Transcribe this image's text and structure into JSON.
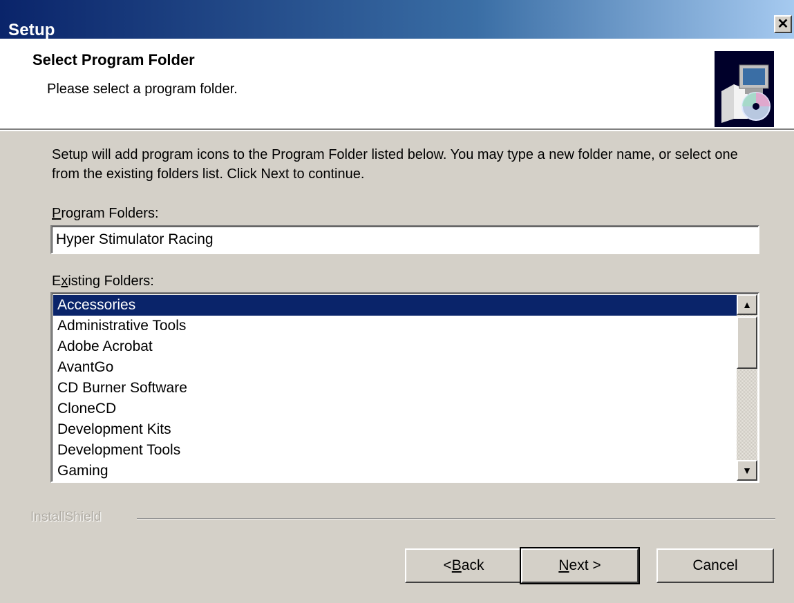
{
  "window": {
    "title": "Setup"
  },
  "header": {
    "title": "Select Program Folder",
    "subtitle": "Please select a program folder.",
    "icon": "setup-computer-cd-icon"
  },
  "instructions": "Setup will add program icons to the Program Folder listed below.  You may type a new folder name, or select one from the existing folders list.  Click Next to continue.",
  "program_folder": {
    "label_accel": "P",
    "label_rest": "rogram Folders:",
    "value": "Hyper Stimulator Racing"
  },
  "existing_folders": {
    "label_pre": "E",
    "label_accel": "x",
    "label_rest": "isting Folders:",
    "items": [
      "Accessories",
      "Administrative Tools",
      "Adobe Acrobat",
      "AvantGo",
      "CD Burner Software",
      "CloneCD",
      "Development Kits",
      "Development Tools",
      "Gaming"
    ],
    "selected": "Accessories"
  },
  "footer": {
    "brand": "InstallShield"
  },
  "buttons": {
    "back_pre": "< ",
    "back_accel": "B",
    "back_rest": "ack",
    "next_accel": "N",
    "next_rest": "ext >",
    "cancel": "Cancel"
  },
  "colors": {
    "selection": "#0a246a",
    "face": "#d4d0c8",
    "title_start": "#0a246a",
    "title_end": "#a6caf0"
  }
}
